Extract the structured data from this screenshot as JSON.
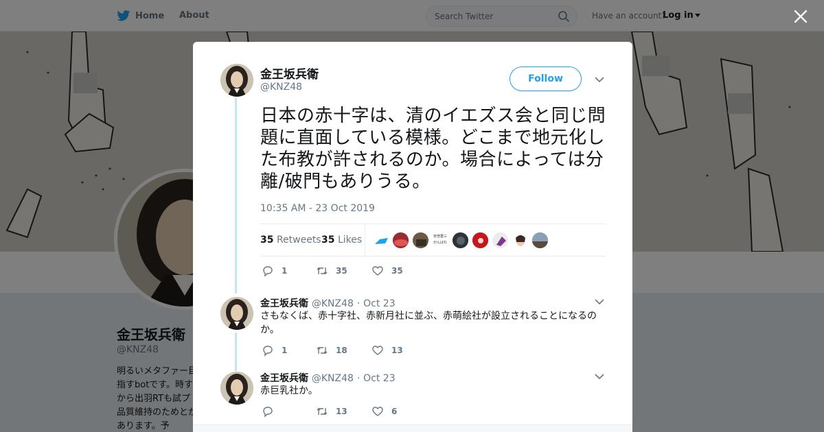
{
  "nav": {
    "home_label": "Home",
    "about_label": "About",
    "search_placeholder": "Search Twitter",
    "have_account": "Have an account?",
    "login_label": "Log in"
  },
  "profile_bg": {
    "name": "金王坂兵衛",
    "handle": "@KNZ48",
    "bio": "明るいメタファー目指すbotです。時すから出羽RTも試プ品質維持のためとがあります。予"
  },
  "tweet": {
    "author_name": "金王坂兵衛",
    "author_handle": "@KNZ48",
    "follow_label": "Follow",
    "text": "日本の赤十字は、清のイエズス会と同じ問題に直面している模様。どこまで地元化した布教が許されるのか。場合によっては分離/破門もありうる。",
    "timestamp": "10:35 AM - 23 Oct 2019",
    "retweets_count": "35",
    "retweets_label": "Retweets",
    "likes_count": "35",
    "likes_label": "Likes",
    "liker_avatar_tiny_text": [
      "安倍晋三",
      "がんばれ"
    ],
    "actions": {
      "replies": "1",
      "retweets": "35",
      "likes": "35"
    }
  },
  "replies": [
    {
      "author_name": "金王坂兵衛",
      "author_handle": "@KNZ48",
      "date": "Oct 23",
      "text": "さもなくば、赤十字社、赤新月社に並ぶ、赤萌絵社が設立されることになるのか。",
      "actions": {
        "replies": "1",
        "retweets": "18",
        "likes": "13"
      }
    },
    {
      "author_name": "金王坂兵衛",
      "author_handle": "@KNZ48",
      "date": "Oct 23",
      "text": "赤巨乳社か。",
      "actions": {
        "replies": "",
        "retweets": "13",
        "likes": "6"
      }
    }
  ],
  "colors": {
    "brand_blue": "#1da1f2",
    "thread_line": "#c4e5f7",
    "muted_text": "#657786"
  }
}
